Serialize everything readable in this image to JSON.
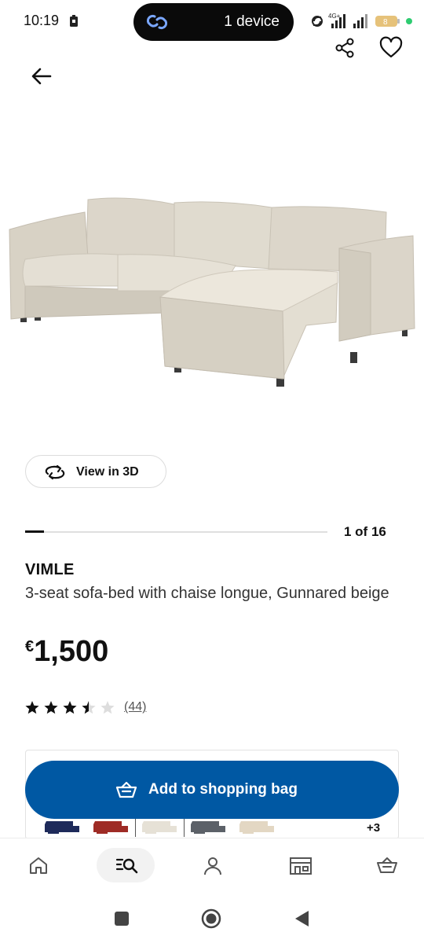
{
  "status_bar": {
    "time": "10:19",
    "cast_label": "1 device",
    "network": "4G+",
    "battery": "8",
    "icons": [
      "sim-icon",
      "link-icon",
      "signal-icon",
      "battery-icon"
    ]
  },
  "header": {
    "back_icon": "arrow-left-icon",
    "share_icon": "share-icon",
    "favorite_icon": "heart-icon"
  },
  "gallery": {
    "view_3d_label": "View in 3D",
    "counter": "1 of 16",
    "progress_fraction": 0.0625
  },
  "product": {
    "name": "VIMLE",
    "description": "3-seat sofa-bed with chaise longue, Gunnared beige",
    "currency": "€",
    "price": "1,500",
    "rating_value": 3.5,
    "rating_max": 5,
    "review_count": "(44)"
  },
  "variants": {
    "swatch_colors": [
      "#1e2a5a",
      "#9e2b25",
      "#e6e1d6",
      "#5c6168",
      "#e3d7c3"
    ],
    "more_label": "+3"
  },
  "cta": {
    "add_to_bag_label": "Add to shopping bag",
    "color": "#0058a3"
  },
  "bottom_nav": {
    "items": [
      "home-icon",
      "search-icon",
      "profile-icon",
      "store-icon",
      "bag-icon"
    ],
    "active": "search-icon"
  },
  "system_nav": [
    "recents-icon",
    "home-circle-icon",
    "back-triangle-icon"
  ]
}
